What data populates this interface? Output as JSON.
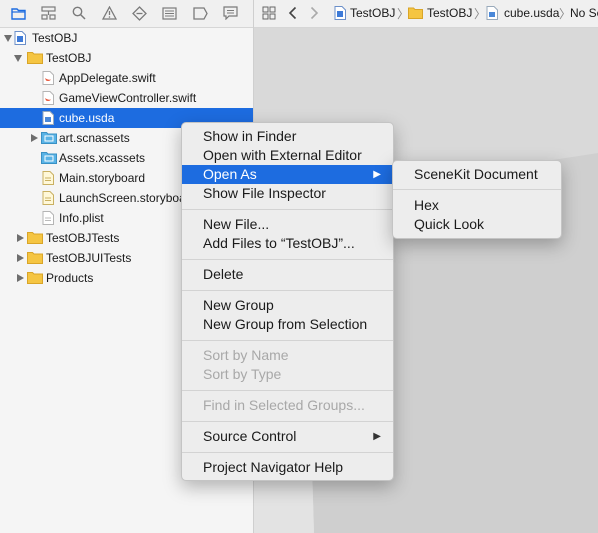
{
  "navigator": {
    "tree": [
      {
        "label": "TestOBJ",
        "kind": "project",
        "indent": 0,
        "disclosure": "open"
      },
      {
        "label": "TestOBJ",
        "kind": "folder",
        "indent": 1,
        "disclosure": "open"
      },
      {
        "label": "AppDelegate.swift",
        "kind": "swift",
        "indent": 2,
        "disclosure": "none"
      },
      {
        "label": "GameViewController.swift",
        "kind": "swift",
        "indent": 2,
        "disclosure": "none"
      },
      {
        "label": "cube.usda",
        "kind": "doc",
        "indent": 2,
        "disclosure": "none",
        "selected": true
      },
      {
        "label": "art.scnassets",
        "kind": "bluefolder",
        "indent": 2,
        "disclosure": "closed"
      },
      {
        "label": "Assets.xcassets",
        "kind": "bluefolder",
        "indent": 2,
        "disclosure": "none"
      },
      {
        "label": "Main.storyboard",
        "kind": "storyboard",
        "indent": 2,
        "disclosure": "none"
      },
      {
        "label": "LaunchScreen.storyboard",
        "kind": "storyboard",
        "indent": 2,
        "disclosure": "none"
      },
      {
        "label": "Info.plist",
        "kind": "plist",
        "indent": 2,
        "disclosure": "none"
      },
      {
        "label": "TestOBJTests",
        "kind": "folder",
        "indent": 1,
        "disclosure": "closed"
      },
      {
        "label": "TestOBJUITests",
        "kind": "folder",
        "indent": 1,
        "disclosure": "closed"
      },
      {
        "label": "Products",
        "kind": "folder",
        "indent": 1,
        "disclosure": "closed"
      }
    ]
  },
  "editor": {
    "breadcrumbs": [
      "TestOBJ",
      "TestOBJ",
      "cube.usda",
      "No Se"
    ]
  },
  "context_menu": {
    "items": [
      {
        "label": "Show in Finder"
      },
      {
        "label": "Open with External Editor"
      },
      {
        "label": "Open As",
        "submenu": true,
        "highlighted": true
      },
      {
        "label": "Show File Inspector"
      },
      {
        "separator": true
      },
      {
        "label": "New File..."
      },
      {
        "label": "Add Files to “TestOBJ”..."
      },
      {
        "separator": true
      },
      {
        "label": "Delete"
      },
      {
        "separator": true
      },
      {
        "label": "New Group"
      },
      {
        "label": "New Group from Selection"
      },
      {
        "separator": true
      },
      {
        "label": "Sort by Name",
        "disabled": true
      },
      {
        "label": "Sort by Type",
        "disabled": true
      },
      {
        "separator": true
      },
      {
        "label": "Find in Selected Groups...",
        "disabled": true
      },
      {
        "separator": true
      },
      {
        "label": "Source Control",
        "submenu": true
      },
      {
        "separator": true
      },
      {
        "label": "Project Navigator Help"
      }
    ]
  },
  "submenu": {
    "items": [
      {
        "label": "SceneKit Document"
      },
      {
        "separator": true
      },
      {
        "label": "Hex"
      },
      {
        "label": "Quick Look"
      }
    ]
  },
  "colors": {
    "selection": "#1d6ce0",
    "folder": "#f5c542",
    "blue_folder": "#59b3e6"
  }
}
